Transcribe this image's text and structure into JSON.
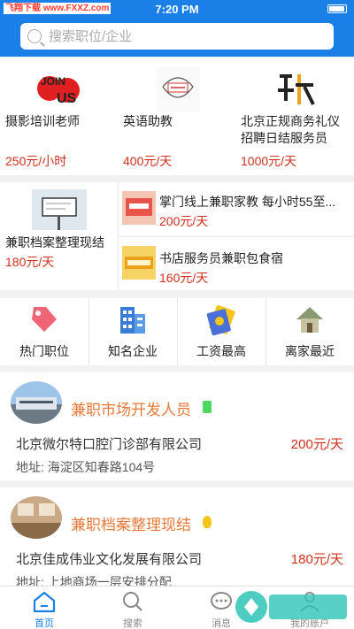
{
  "status_bar": {
    "time": "7:20 PM",
    "watermark": "飞翔下载 www.FXXZ.com"
  },
  "search": {
    "placeholder": "搜索职位/企业"
  },
  "top_jobs": [
    {
      "title": "摄影培训老师",
      "price": "250元/小时",
      "image": "join-us-logo"
    },
    {
      "title": "英语助教",
      "price": "400元/天",
      "image": "recruit-sketch"
    },
    {
      "title": "北京正规商务礼仪招聘日结服务员",
      "price": "1000元/天",
      "image": "que-character-logo"
    }
  ],
  "featured": {
    "left": {
      "title": "兼职档案整理现结",
      "price": "180元/天",
      "image": "billboard-photo"
    },
    "right": [
      {
        "title": "掌门线上兼职家教 每小时55至...",
        "price": "200元/天",
        "image": "promo-banner"
      },
      {
        "title": "书店服务员兼职包食宿",
        "price": "160元/天",
        "image": "hiring-banner"
      }
    ]
  },
  "categories": [
    {
      "label": "热门职位",
      "icon": "tag-icon"
    },
    {
      "label": "知名企业",
      "icon": "building-icon"
    },
    {
      "label": "工资最高",
      "icon": "money-icon"
    },
    {
      "label": "离家最近",
      "icon": "house-icon"
    }
  ],
  "listings": [
    {
      "title": "兼职市场开发人员",
      "company": "北京微尔特口腔门诊部有限公司",
      "pay": "200元/天",
      "address": "地址: 海淀区知春路104号",
      "tag_color": "#4cd964"
    },
    {
      "title": "兼职档案整理现结",
      "company": "北京佳成伟业文化发展有限公司",
      "pay": "180元/天",
      "address": "地址: 上地商场一层安排分配",
      "tag_color": "#f5c518"
    }
  ],
  "tabs": [
    {
      "label": "首页",
      "icon": "home-icon",
      "active": true
    },
    {
      "label": "搜索",
      "icon": "search-icon",
      "active": false
    },
    {
      "label": "消息",
      "icon": "message-icon",
      "active": false
    },
    {
      "label": "我的账户",
      "icon": "user-icon",
      "active": false
    }
  ],
  "colors": {
    "primary": "#1a7fe6",
    "price": "#d0301e",
    "job_title": "#e77a3a"
  }
}
